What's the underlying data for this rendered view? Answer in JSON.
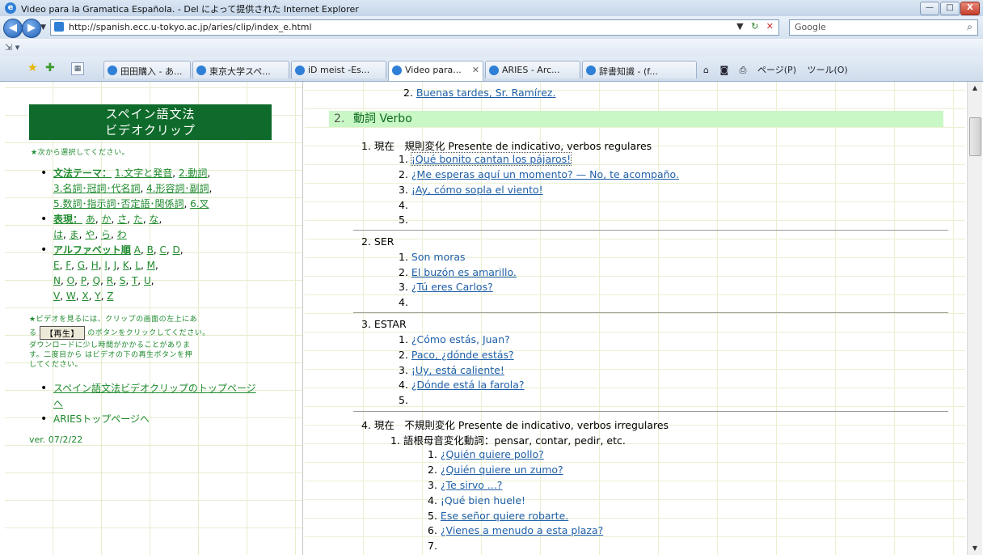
{
  "window": {
    "title": "Video para la Gramatica Española. - Del によって提供された Internet Explorer",
    "buttons": {
      "minimize": "—",
      "maximize": "□",
      "close": "X"
    }
  },
  "address": {
    "url": "http://spanish.ecc.u-tokyo.ac.jp/aries/clip/index_e.html",
    "search_placeholder": "Google"
  },
  "tabs": [
    {
      "label": "田田購入 - あ..."
    },
    {
      "label": "東京大学スペ..."
    },
    {
      "label": "iD meist -Es..."
    },
    {
      "label": "Video para...",
      "active": true
    },
    {
      "label": "ARIES - Arc..."
    },
    {
      "label": "辞書知識 - (f..."
    }
  ],
  "commands": {
    "home": "⌂",
    "feeds": "◙",
    "print": "⎙",
    "page": "ページ(P)",
    "tools": "ツール(O)"
  },
  "sidebar": {
    "title_line1": "スペイン語文法",
    "title_line2": "ビデオクリップ",
    "intro": "★次から選択してください。",
    "items": [
      {
        "label": "文法テーマ：",
        "links": [
          "1.文字と発音",
          "2.動詞",
          "3.名詞･冠詞･代名詞",
          "4.形容詞･副詞",
          "5.数詞･指示詞･否定語･関係詞",
          "6.叉"
        ]
      },
      {
        "label": "表現：",
        "links": [
          "あ",
          "か",
          "さ",
          "た",
          "な",
          "は",
          "ま",
          "や",
          "ら",
          "わ"
        ]
      },
      {
        "label": "アルファベット順",
        "links": [
          "A",
          "B",
          "C",
          "D",
          "E",
          "F",
          "G",
          "H",
          "I",
          "J",
          "K",
          "L",
          "M",
          "N",
          "O",
          "P",
          "Q",
          "R",
          "S",
          "T",
          "U",
          "V",
          "W",
          "X",
          "Y",
          "Z"
        ]
      }
    ],
    "video_note_1": "★ビデオを見るには、クリップの画面の左上にあ",
    "video_note_2a": "る",
    "play_button": "【再生】",
    "video_note_2b": "のボタンをクリックしてください。",
    "video_note_3": "ダウンロードに少し時間がかかることがありま",
    "video_note_4": "す。二度目から はビデオの下の再生ボタンを押",
    "video_note_5": "してください。",
    "bottom_links": [
      "スペイン語文法ビデオクリップのトップページへ",
      "ARIESトップページへ"
    ],
    "version": "ver. 07/2/22"
  },
  "content": {
    "top_item": {
      "num": "2.",
      "text": "Buenas tardes, Sr. Ramírez."
    },
    "section": {
      "num": "2.",
      "title": "動詞 Verbo"
    },
    "groups": [
      {
        "num": "1.",
        "title": "現在　規則変化 Presente de indicativo, verbos regulares",
        "items": [
          {
            "num": "1.",
            "text": "¡Qué bonito cantan los pájaros!"
          },
          {
            "num": "2.",
            "text": "¿Me esperas aquí un momento? — No, te acompaño."
          },
          {
            "num": "3.",
            "text": "¡Ay, cómo sopla el viento!"
          },
          {
            "num": "4.",
            "text": ""
          },
          {
            "num": "5.",
            "text": ""
          }
        ]
      },
      {
        "num": "2.",
        "title": "SER",
        "items": [
          {
            "num": "1.",
            "text": "Son moras"
          },
          {
            "num": "2.",
            "text": "El buzón es amarillo."
          },
          {
            "num": "3.",
            "text": "¿Tú eres Carlos?"
          },
          {
            "num": "4.",
            "text": ""
          }
        ]
      },
      {
        "num": "3.",
        "title": "ESTAR",
        "items": [
          {
            "num": "1.",
            "text": "¿Cómo estás, Juan?"
          },
          {
            "num": "2.",
            "text": "Paco, ¿dónde estás?"
          },
          {
            "num": "3.",
            "text": "¡Uy, está caliente!"
          },
          {
            "num": "4.",
            "text": "¿Dónde está la farola?"
          },
          {
            "num": "5.",
            "text": ""
          }
        ]
      },
      {
        "num": "4.",
        "title": "現在　不規則変化 Presente de indicativo, verbos irregulares",
        "sub": {
          "num": "1.",
          "title": "語根母音変化動詞：pensar, contar, pedir, etc."
        },
        "items": [
          {
            "num": "1.",
            "text": "¿Quién quiere pollo?"
          },
          {
            "num": "2.",
            "text": "¿Quién quiere un zumo?"
          },
          {
            "num": "3.",
            "text": "¿Te sirvo ...?"
          },
          {
            "num": "4.",
            "text": "¡Qué bien huele!"
          },
          {
            "num": "5.",
            "text": "Ese señor quiere robarte."
          },
          {
            "num": "6.",
            "text": "¿Vienes a menudo a esta plaza?"
          },
          {
            "num": "7.",
            "text": ""
          }
        ]
      }
    ]
  }
}
